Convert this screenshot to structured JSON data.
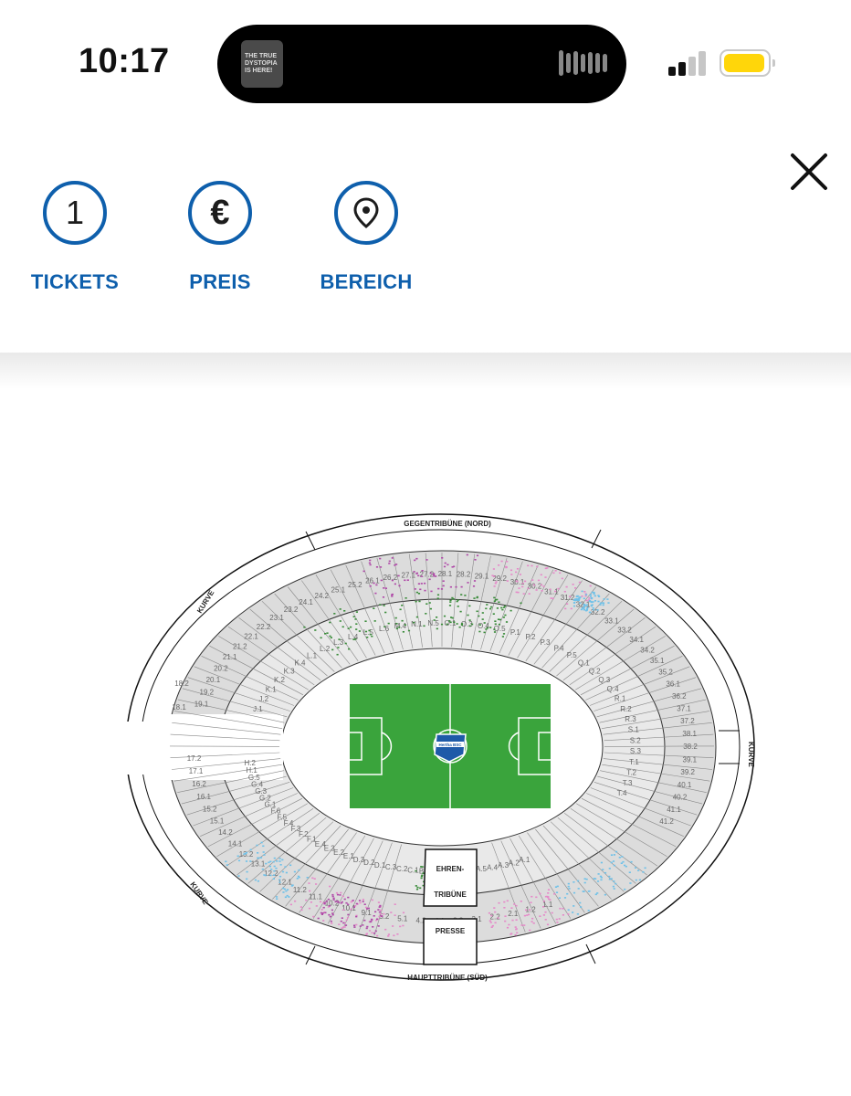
{
  "status_bar": {
    "time": "10:17",
    "live_activity_art_text": "THE TRUE DYSTOPIA IS HERE!",
    "battery_color": "#ffd60a"
  },
  "filters": [
    {
      "label": "TICKETS",
      "value": "1",
      "icon": "number-circle"
    },
    {
      "label": "PREIS",
      "value": "€",
      "icon": "euro-icon"
    },
    {
      "label": "BEREICH",
      "value": "",
      "icon": "location-pin-icon"
    }
  ],
  "colors": {
    "accent_blue": "#0e5fac",
    "pitch_green": "#3aa43c",
    "seat_pink": "#e58ac9",
    "seat_purple": "#b04aa8",
    "seat_green": "#3a8c3a",
    "seat_blue": "#6fc1e8"
  },
  "stadium": {
    "stand_labels": {
      "north": "GEGENTRIBÜNE (NORD)",
      "south": "HAUPTTRIBÜNE (SÜD)",
      "curve_left_top": "KURVE",
      "curve_left_bottom": "KURVE",
      "curve_right": "KURVE",
      "ehrentribuene_line1": "EHREN-",
      "ehrentribuene_line2": "TRIBÜNE",
      "presse": "PRESSE"
    },
    "upper_ring_sections": [
      "19.1",
      "19.2",
      "20.1",
      "20.2",
      "21.1",
      "21.2",
      "22.1",
      "22.2",
      "23.1",
      "23.2",
      "24.1",
      "24.2",
      "25.1",
      "25.2",
      "26.1",
      "26.2",
      "27.1",
      "27.2",
      "28.1",
      "28.2",
      "29.1",
      "29.2",
      "30.1",
      "30.2",
      "31.1",
      "31.2",
      "32.1",
      "32.2",
      "33.1",
      "33.2",
      "34.1",
      "34.2",
      "35.1",
      "35.2",
      "36.1",
      "36.2",
      "37.1",
      "37.2",
      "38.1",
      "38.2",
      "39.1",
      "39.2",
      "40.1",
      "40.2",
      "41.1",
      "41.2"
    ],
    "lower_ring_sections": [
      "J.1",
      "J.2",
      "K.1",
      "K.2",
      "K.3",
      "K.4",
      "L.1",
      "L.2",
      "L.3",
      "L.4",
      "L.5",
      "L.6",
      "M.4",
      "N.1",
      "N.5",
      "O.1",
      "O.3",
      "O.4",
      "O.5",
      "P.1",
      "P.2",
      "P.3",
      "P.4",
      "P.5",
      "Q.1",
      "Q.2",
      "Q.3",
      "Q.4",
      "R.1",
      "R.2",
      "R.3",
      "S.1",
      "S.2",
      "S.3",
      "T.1",
      "T.2",
      "T.3",
      "T.4"
    ],
    "south_upper_sections": [
      "17.2",
      "17.1",
      "16.2",
      "16.1",
      "15.2",
      "15.1",
      "14.2",
      "14.1",
      "13.2",
      "13.1",
      "12.2",
      "12.1",
      "11.2",
      "11.1",
      "10.2",
      "10.1",
      "9.1",
      "5.2",
      "5.1",
      "4.2",
      "4.1",
      "3.2",
      "3.1",
      "2.2",
      "2.1",
      "1.2",
      "1.1"
    ],
    "south_lower_sections": [
      "H.2",
      "H.1",
      "G.5",
      "G.4",
      "G.3",
      "G.2",
      "G.1",
      "F.6",
      "F.5",
      "F.4",
      "F.3",
      "F.2",
      "F.1",
      "E.4",
      "E.3",
      "E.2",
      "E.1",
      "D.3",
      "D.2",
      "D.1",
      "C.3",
      "C.2",
      "C.1",
      "B.4",
      "B.3",
      "B.2",
      "B.1",
      "A.6",
      "A.5",
      "A.4",
      "A.3",
      "A.2",
      "A.1"
    ],
    "west_block_sections": [
      "18.1",
      "18.2"
    ],
    "club_logo": "Hertha BSC"
  }
}
